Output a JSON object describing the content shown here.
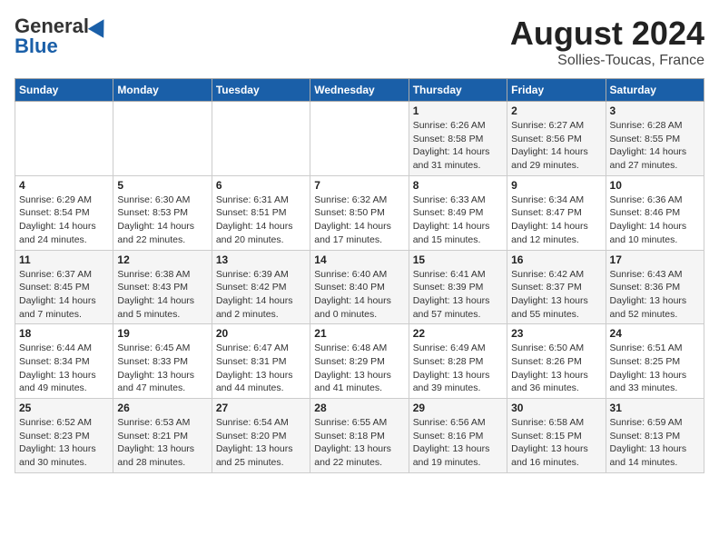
{
  "header": {
    "logo_general": "General",
    "logo_blue": "Blue",
    "title": "August 2024",
    "subtitle": "Sollies-Toucas, France"
  },
  "calendar": {
    "days": [
      "Sunday",
      "Monday",
      "Tuesday",
      "Wednesday",
      "Thursday",
      "Friday",
      "Saturday"
    ],
    "weeks": [
      [
        {
          "date": "",
          "info": ""
        },
        {
          "date": "",
          "info": ""
        },
        {
          "date": "",
          "info": ""
        },
        {
          "date": "",
          "info": ""
        },
        {
          "date": "1",
          "info": "Sunrise: 6:26 AM\nSunset: 8:58 PM\nDaylight: 14 hours and 31 minutes."
        },
        {
          "date": "2",
          "info": "Sunrise: 6:27 AM\nSunset: 8:56 PM\nDaylight: 14 hours and 29 minutes."
        },
        {
          "date": "3",
          "info": "Sunrise: 6:28 AM\nSunset: 8:55 PM\nDaylight: 14 hours and 27 minutes."
        }
      ],
      [
        {
          "date": "4",
          "info": "Sunrise: 6:29 AM\nSunset: 8:54 PM\nDaylight: 14 hours and 24 minutes."
        },
        {
          "date": "5",
          "info": "Sunrise: 6:30 AM\nSunset: 8:53 PM\nDaylight: 14 hours and 22 minutes."
        },
        {
          "date": "6",
          "info": "Sunrise: 6:31 AM\nSunset: 8:51 PM\nDaylight: 14 hours and 20 minutes."
        },
        {
          "date": "7",
          "info": "Sunrise: 6:32 AM\nSunset: 8:50 PM\nDaylight: 14 hours and 17 minutes."
        },
        {
          "date": "8",
          "info": "Sunrise: 6:33 AM\nSunset: 8:49 PM\nDaylight: 14 hours and 15 minutes."
        },
        {
          "date": "9",
          "info": "Sunrise: 6:34 AM\nSunset: 8:47 PM\nDaylight: 14 hours and 12 minutes."
        },
        {
          "date": "10",
          "info": "Sunrise: 6:36 AM\nSunset: 8:46 PM\nDaylight: 14 hours and 10 minutes."
        }
      ],
      [
        {
          "date": "11",
          "info": "Sunrise: 6:37 AM\nSunset: 8:45 PM\nDaylight: 14 hours and 7 minutes."
        },
        {
          "date": "12",
          "info": "Sunrise: 6:38 AM\nSunset: 8:43 PM\nDaylight: 14 hours and 5 minutes."
        },
        {
          "date": "13",
          "info": "Sunrise: 6:39 AM\nSunset: 8:42 PM\nDaylight: 14 hours and 2 minutes."
        },
        {
          "date": "14",
          "info": "Sunrise: 6:40 AM\nSunset: 8:40 PM\nDaylight: 14 hours and 0 minutes."
        },
        {
          "date": "15",
          "info": "Sunrise: 6:41 AM\nSunset: 8:39 PM\nDaylight: 13 hours and 57 minutes."
        },
        {
          "date": "16",
          "info": "Sunrise: 6:42 AM\nSunset: 8:37 PM\nDaylight: 13 hours and 55 minutes."
        },
        {
          "date": "17",
          "info": "Sunrise: 6:43 AM\nSunset: 8:36 PM\nDaylight: 13 hours and 52 minutes."
        }
      ],
      [
        {
          "date": "18",
          "info": "Sunrise: 6:44 AM\nSunset: 8:34 PM\nDaylight: 13 hours and 49 minutes."
        },
        {
          "date": "19",
          "info": "Sunrise: 6:45 AM\nSunset: 8:33 PM\nDaylight: 13 hours and 47 minutes."
        },
        {
          "date": "20",
          "info": "Sunrise: 6:47 AM\nSunset: 8:31 PM\nDaylight: 13 hours and 44 minutes."
        },
        {
          "date": "21",
          "info": "Sunrise: 6:48 AM\nSunset: 8:29 PM\nDaylight: 13 hours and 41 minutes."
        },
        {
          "date": "22",
          "info": "Sunrise: 6:49 AM\nSunset: 8:28 PM\nDaylight: 13 hours and 39 minutes."
        },
        {
          "date": "23",
          "info": "Sunrise: 6:50 AM\nSunset: 8:26 PM\nDaylight: 13 hours and 36 minutes."
        },
        {
          "date": "24",
          "info": "Sunrise: 6:51 AM\nSunset: 8:25 PM\nDaylight: 13 hours and 33 minutes."
        }
      ],
      [
        {
          "date": "25",
          "info": "Sunrise: 6:52 AM\nSunset: 8:23 PM\nDaylight: 13 hours and 30 minutes."
        },
        {
          "date": "26",
          "info": "Sunrise: 6:53 AM\nSunset: 8:21 PM\nDaylight: 13 hours and 28 minutes."
        },
        {
          "date": "27",
          "info": "Sunrise: 6:54 AM\nSunset: 8:20 PM\nDaylight: 13 hours and 25 minutes."
        },
        {
          "date": "28",
          "info": "Sunrise: 6:55 AM\nSunset: 8:18 PM\nDaylight: 13 hours and 22 minutes."
        },
        {
          "date": "29",
          "info": "Sunrise: 6:56 AM\nSunset: 8:16 PM\nDaylight: 13 hours and 19 minutes."
        },
        {
          "date": "30",
          "info": "Sunrise: 6:58 AM\nSunset: 8:15 PM\nDaylight: 13 hours and 16 minutes."
        },
        {
          "date": "31",
          "info": "Sunrise: 6:59 AM\nSunset: 8:13 PM\nDaylight: 13 hours and 14 minutes."
        }
      ]
    ]
  }
}
